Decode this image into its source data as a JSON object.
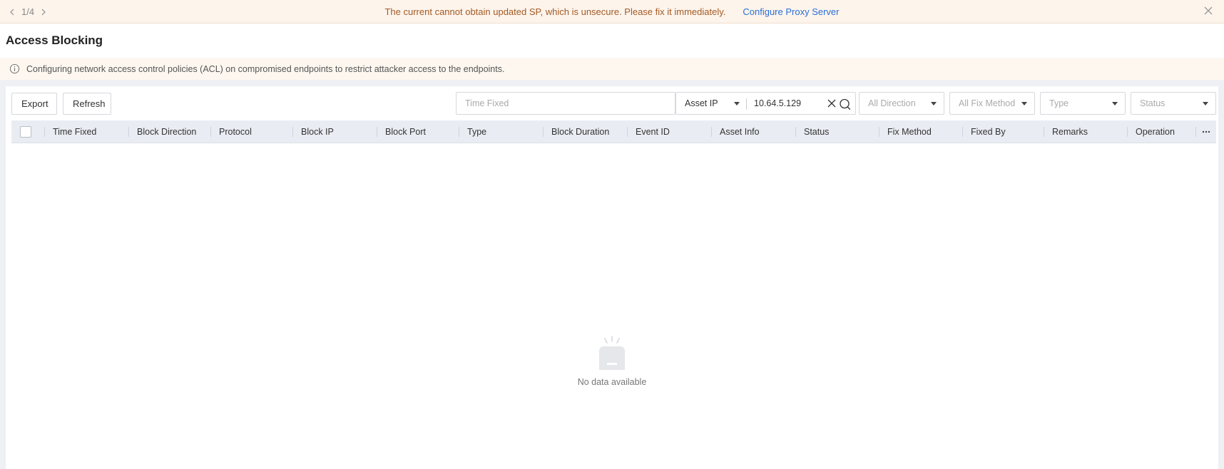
{
  "banner": {
    "pager": "1/4",
    "message": "The current cannot obtain updated SP, which is unsecure. Please fix it immediately.",
    "link": "Configure Proxy Server"
  },
  "page": {
    "title": "Access Blocking",
    "info": "Configuring network access control policies (ACL) on compromised endpoints to restrict attacker access to the endpoints."
  },
  "toolbar": {
    "export_label": "Export",
    "refresh_label": "Refresh",
    "time_fixed_placeholder": "Time Fixed",
    "asset_select": "Asset IP",
    "asset_value": "10.64.5.129",
    "direction": "All Direction",
    "fix_method": "All Fix Method",
    "type": "Type",
    "status": "Status"
  },
  "table": {
    "columns": [
      "Time Fixed",
      "Block Direction",
      "Protocol",
      "Block IP",
      "Block Port",
      "Type",
      "Block Duration",
      "Event ID",
      "Asset Info",
      "Status",
      "Fix Method",
      "Fixed By",
      "Remarks",
      "Operation"
    ],
    "empty_text": "No data available"
  },
  "colors": {
    "banner_bg": "#fdf4ec",
    "banner_text": "#a35a24",
    "link": "#2b6fd6",
    "table_header_bg": "#e9ecf2"
  }
}
